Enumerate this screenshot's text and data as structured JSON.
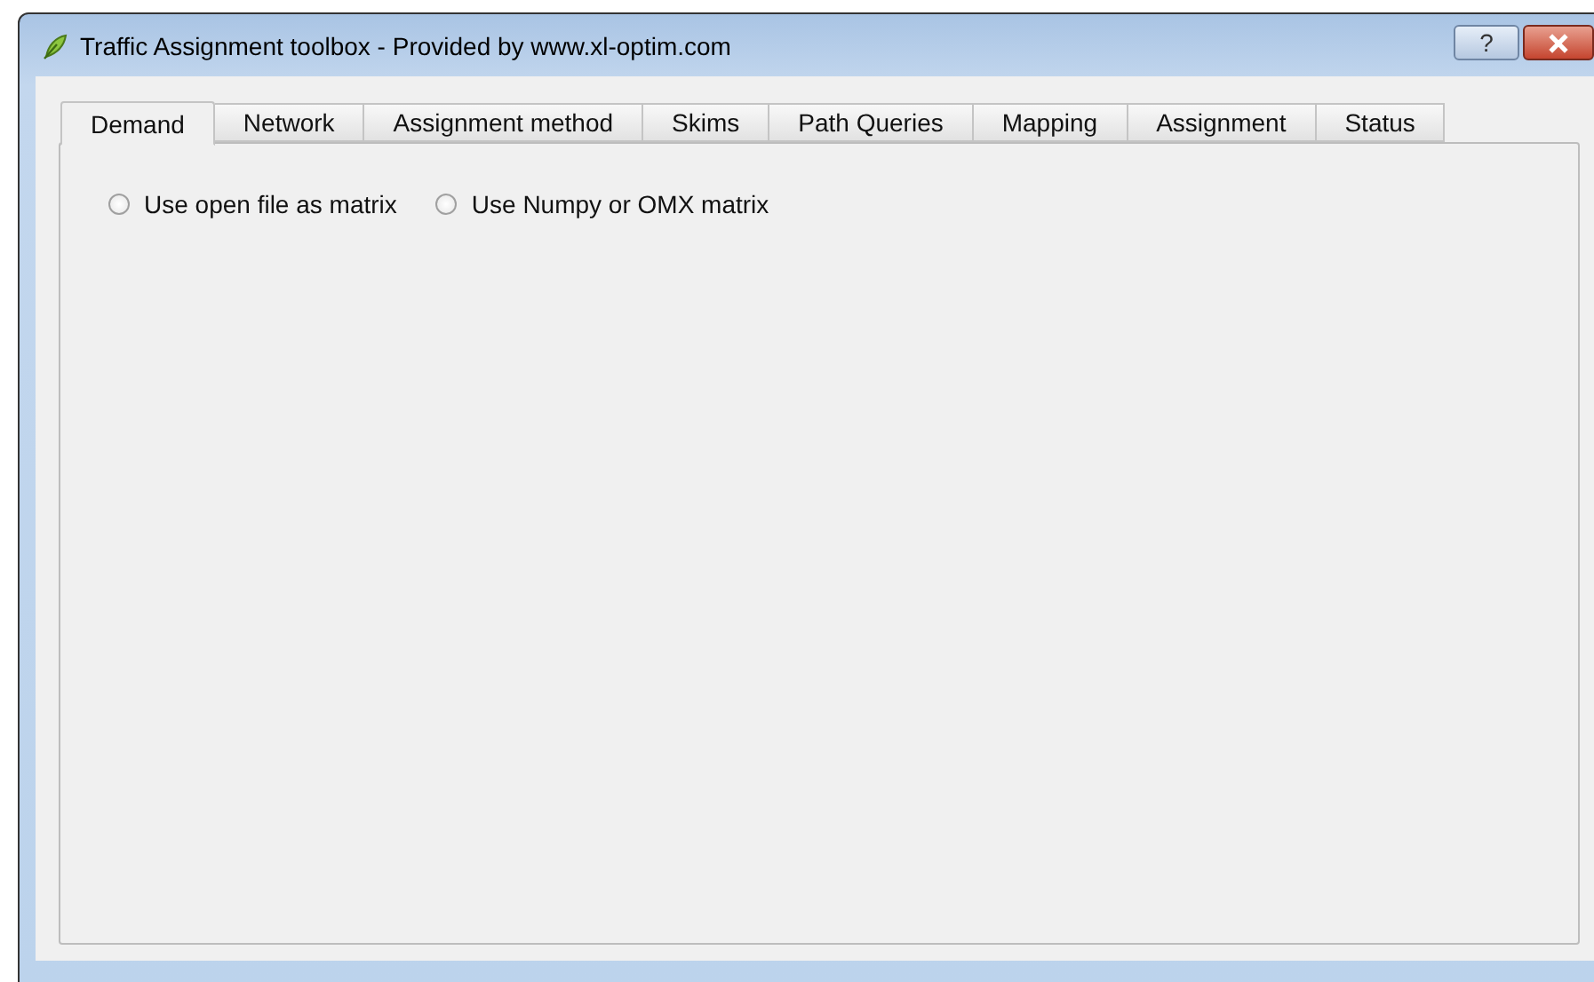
{
  "window": {
    "title": "Traffic Assignment toolbox - Provided by www.xl-optim.com",
    "help_button": "?"
  },
  "tabs": [
    {
      "label": "Demand",
      "selected": true
    },
    {
      "label": "Network",
      "selected": false
    },
    {
      "label": "Assignment method",
      "selected": false
    },
    {
      "label": "Skims",
      "selected": false
    },
    {
      "label": "Path Queries",
      "selected": false
    },
    {
      "label": "Mapping",
      "selected": false
    },
    {
      "label": "Assignment",
      "selected": false
    },
    {
      "label": "Status",
      "selected": false
    }
  ],
  "options": [
    {
      "label": "Use open file as matrix",
      "checked": false
    },
    {
      "label": "Use Numpy or OMX matrix",
      "checked": false
    }
  ]
}
